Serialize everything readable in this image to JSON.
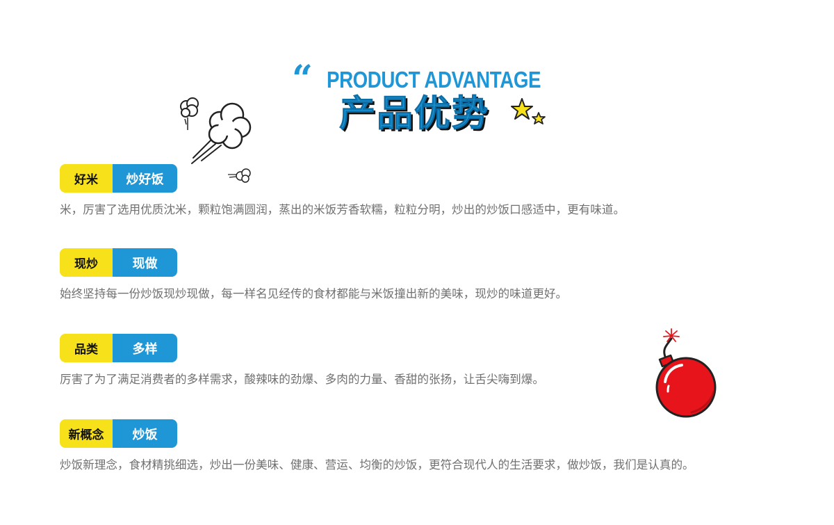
{
  "header": {
    "quote_mark": "“",
    "title_en": "PRODUCT ADVANTAGE",
    "title_cn": "产品优势"
  },
  "colors": {
    "accent_blue": "#1f96d6",
    "accent_yellow": "#f7e11a",
    "body_text": "#707070",
    "bomb_red": "#e8141c"
  },
  "decorations": {
    "puff": "smoke-puff-icon",
    "stars": "star-icon",
    "bomb": "bomb-icon"
  },
  "sections": [
    {
      "tag_primary": "好米",
      "tag_secondary": "炒好饭",
      "description": "米，厉害了选用优质沈米，颗粒饱满圆润，蒸出的米饭芳香软糯，粒粒分明，炒出的炒饭口感适中，更有味道。"
    },
    {
      "tag_primary": "现炒",
      "tag_secondary": "现做",
      "description": "始终坚持每一份炒饭现炒现做，每一样名见经传的食材都能与米饭撞出新的美味，现炒的味道更好。"
    },
    {
      "tag_primary": "品类",
      "tag_secondary": "多样",
      "description": "厉害了为了满足消费者的多样需求，酸辣味的劲爆、多肉的力量、香甜的张扬，让舌尖嗨到爆。"
    },
    {
      "tag_primary": "新概念",
      "tag_secondary": "炒饭",
      "description": "炒饭新理念，食材精挑细选，炒出一份美味、健康、营运、均衡的炒饭，更符合现代人的生活要求，做炒饭，我们是认真的。"
    }
  ]
}
